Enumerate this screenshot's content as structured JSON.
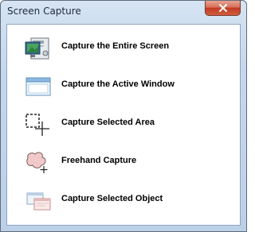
{
  "window": {
    "title": "Screen Capture"
  },
  "icons": {
    "close": "close-icon"
  },
  "options": [
    {
      "label": "Capture the Entire Screen",
      "icon": "entire-screen-icon"
    },
    {
      "label": "Capture the Active Window",
      "icon": "active-window-icon"
    },
    {
      "label": "Capture Selected Area",
      "icon": "selected-area-icon"
    },
    {
      "label": "Freehand Capture",
      "icon": "freehand-capture-icon"
    },
    {
      "label": "Capture Selected Object",
      "icon": "selected-object-icon"
    }
  ],
  "colors": {
    "close_button": "#c23b22",
    "window_frame": "#bcd0e8"
  }
}
